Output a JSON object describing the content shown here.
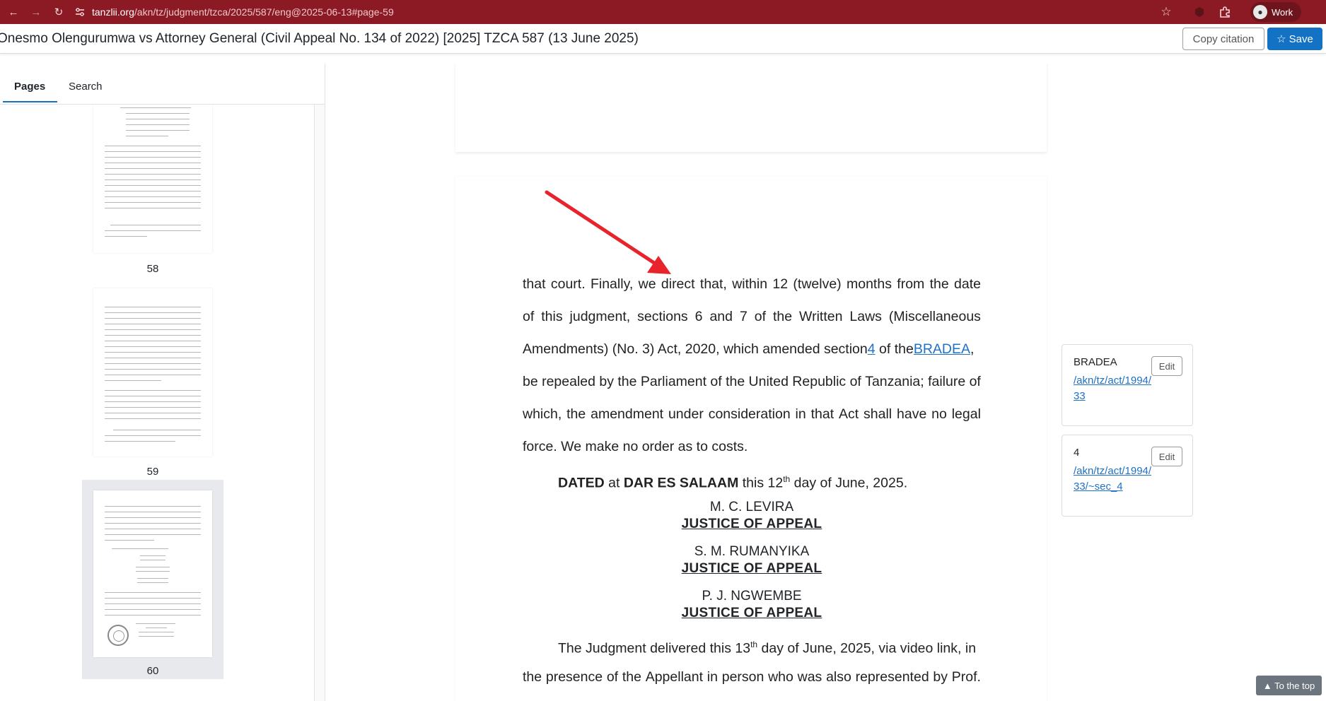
{
  "browser": {
    "url_host": "tanzlii.org",
    "url_path": "/akn/tz/judgment/tzca/2025/587/eng@2025-06-13#page-59",
    "profile_label": "Work",
    "chrome_color": "#8b1a24"
  },
  "header": {
    "title": "Onesmo Olengurumwa vs Attorney General (Civil Appeal No. 134 of 2022) [2025] TZCA 587 (13 June 2025)",
    "copy_citation_label": "Copy citation",
    "save_label": "Save",
    "accent": "#1372c4"
  },
  "sidebar": {
    "tabs": [
      {
        "label": "Pages",
        "active": true
      },
      {
        "label": "Search",
        "active": false
      }
    ],
    "thumbnails": [
      {
        "page": "58",
        "active": false
      },
      {
        "page": "59",
        "active": false
      },
      {
        "page": "60",
        "active": true
      }
    ]
  },
  "document": {
    "lines": [
      [
        "that",
        "court.",
        "Finally,",
        "we",
        "direct",
        "that,",
        "within",
        "12",
        "(twelve)",
        "months",
        "from",
        "the",
        "date"
      ],
      [
        "of",
        "this",
        "judgment,",
        "sections",
        "6",
        "and",
        "7",
        "of",
        "the",
        "Written",
        "Laws",
        "(Miscellaneous"
      ],
      [
        "be",
        "repealed",
        "by",
        "the",
        "Parliament",
        "of",
        "the",
        "United",
        "Republic",
        "of",
        "Tanzania;",
        "failure",
        "of"
      ],
      [
        "which,",
        "the",
        "amendment",
        "under",
        "consideration",
        "in",
        "that",
        "Act",
        "shall",
        "have",
        "no",
        "legal"
      ]
    ],
    "line3": {
      "before": "Amendments) (No. 3) Act, 2020, which amended section",
      "link_section": "4",
      "middle": "4 of the",
      "link_act": "BRADEA",
      "after": ","
    },
    "line_costs": "force. We make no order as to costs.",
    "dated": {
      "dated_word": "DATED",
      "at": " at ",
      "place": "DAR ES SALAAM",
      "this": " this 12",
      "sup": "th",
      "rest": " day of June, 2025."
    },
    "judges": [
      {
        "name": "M. C. LEVIRA",
        "title": "JUSTICE OF APPEAL"
      },
      {
        "name": "S. M. RUMANYIKA",
        "title": "JUSTICE OF APPEAL"
      },
      {
        "name": "P. J. NGWEMBE",
        "title": "JUSTICE OF APPEAL"
      }
    ],
    "delivered": {
      "pre": "The Judgment delivered this 13",
      "sup": "th",
      "post": " day of June, 2025, via video link, in"
    },
    "last_line": [
      "the",
      "presence",
      "of",
      "the",
      "Appellant",
      "in",
      "person",
      "who",
      "was",
      "also",
      "represented",
      "by",
      "Prof."
    ],
    "annotation_arrow_color": "#e8232b"
  },
  "annotations": [
    {
      "label": "BRADEA",
      "link": "/akn/tz/act/1994/33",
      "edit_label": "Edit"
    },
    {
      "label": "4",
      "link": "/akn/tz/act/1994/33/~sec_4",
      "edit_label": "Edit"
    }
  ],
  "to_top_label": "▲ To the top"
}
